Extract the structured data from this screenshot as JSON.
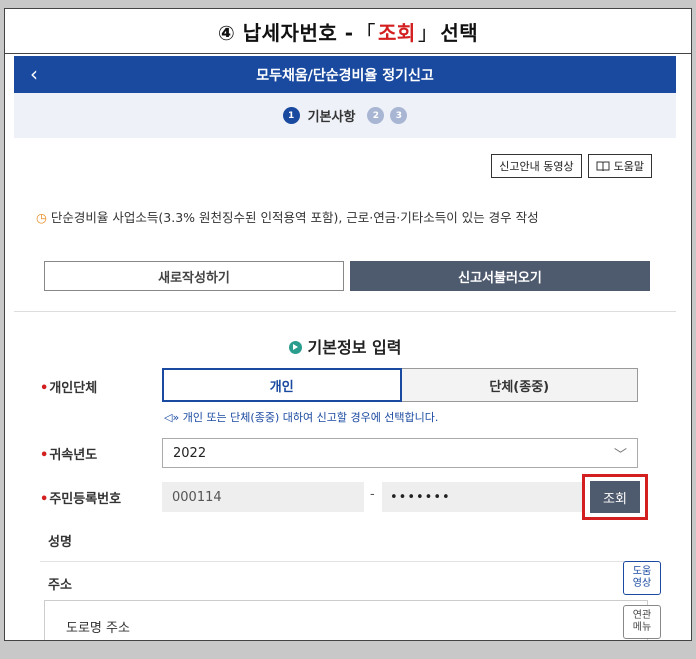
{
  "caption": {
    "prefix": "④ 납세자번호 - ",
    "open": "「",
    "highlight": "조회",
    "close": "」",
    "suffix": " 선택"
  },
  "appbar": {
    "back": "‹",
    "title": "모두채움/단순경비율 정기신고"
  },
  "steps": [
    {
      "num": "1",
      "label": "기본사항",
      "active": true
    },
    {
      "num": "2",
      "label": "",
      "active": false
    },
    {
      "num": "3",
      "label": "",
      "active": false
    }
  ],
  "top_buttons": {
    "video": "신고안내 동영상",
    "help": "도움말"
  },
  "notice": "단순경비율 사업소득(3.3% 원천징수된 인적용역 포함), 근로·연금·기타소득이 있는 경우 작성",
  "actions": {
    "new": "새로작성하기",
    "load": "신고서불러오기"
  },
  "section_title": "기본정보 입력",
  "form": {
    "type_label": "개인단체",
    "type_options": [
      "개인",
      "단체(종중)"
    ],
    "type_hint": "개인 또는 단체(종중) 대하여 신고할 경우에 선택합니다.",
    "year_label": "귀속년도",
    "year_value": "2022",
    "rrn_label": "주민등록번호",
    "rrn_front": "000114",
    "rrn_sep": "-",
    "rrn_back": "•••••••",
    "lookup": "조회",
    "name_label": "성명",
    "address_label": "주소",
    "road_address_label": "도로명 주소"
  },
  "side_buttons": {
    "help_video": [
      "도움",
      "영상"
    ],
    "related_menu": [
      "연관",
      "메뉴"
    ]
  },
  "colors": {
    "primary": "#1a4aa0",
    "highlight": "#d31f1f",
    "dark_button": "#4e5a6e"
  }
}
